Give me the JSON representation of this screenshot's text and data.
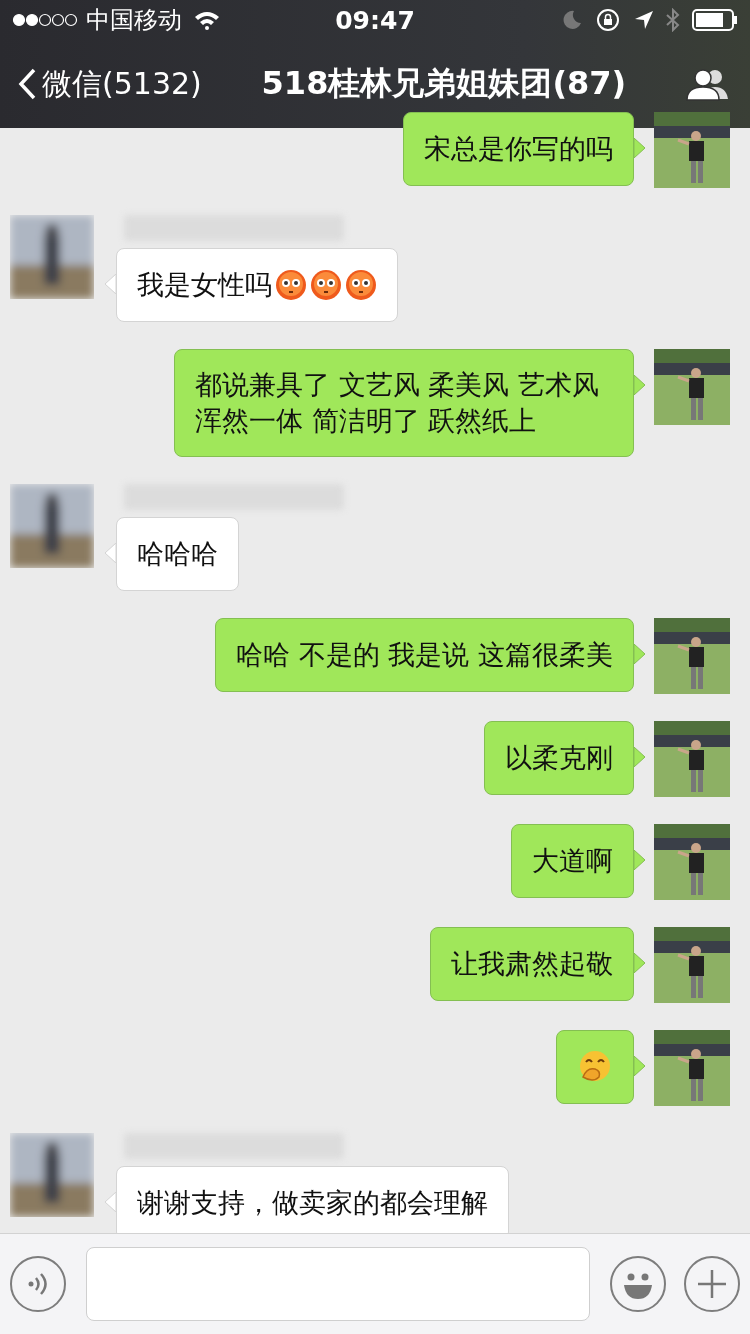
{
  "status_bar": {
    "carrier": "中国移动",
    "time": "09:47"
  },
  "nav_bar": {
    "back_label": "微信(5132)",
    "title": "518桂林兄弟姐妹团(87)"
  },
  "messages": [
    {
      "kind": "outgoing",
      "text": "宋总是你写的吗"
    },
    {
      "kind": "incoming",
      "text": "我是女性吗",
      "emojis": [
        {
          "kind": "flushed"
        },
        {
          "kind": "flushed"
        },
        {
          "kind": "flushed"
        }
      ]
    },
    {
      "kind": "outgoing",
      "text": "都说兼具了 文艺风 柔美风 艺术风浑然一体 简洁明了 跃然纸上"
    },
    {
      "kind": "incoming",
      "text": "哈哈哈"
    },
    {
      "kind": "outgoing",
      "text": "哈哈 不是的 我是说 这篇很柔美"
    },
    {
      "kind": "outgoing",
      "text": "以柔克刚"
    },
    {
      "kind": "outgoing",
      "text": "大道啊"
    },
    {
      "kind": "outgoing",
      "text": "让我肃然起敬"
    },
    {
      "kind": "outgoing",
      "emojis": [
        {
          "kind": "giggle"
        }
      ]
    },
    {
      "kind": "incoming",
      "text": "谢谢支持，做卖家的都会理解"
    }
  ]
}
